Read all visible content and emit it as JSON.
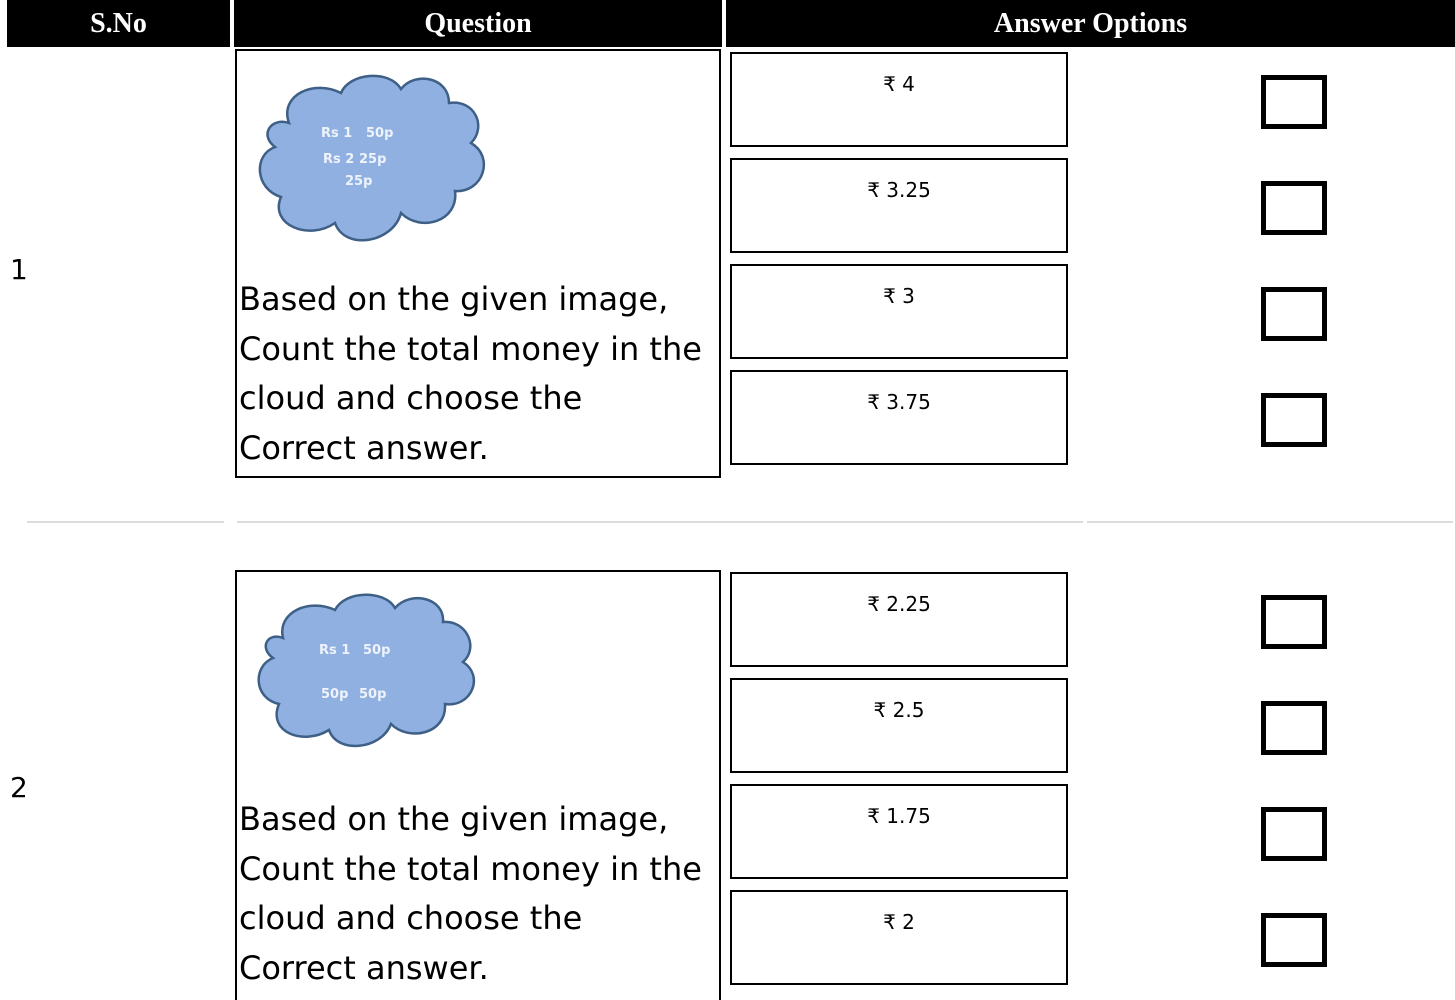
{
  "table": {
    "headers": {
      "sno": "S.No",
      "question": "Question",
      "answer_options": "Answer Options"
    },
    "rows": [
      {
        "sno": "1",
        "cloud_labels": [
          "Rs 1",
          "50p",
          "Rs 2",
          "25p",
          "25p"
        ],
        "question": "Based on the given image, Count the total money in the cloud and choose the Correct answer.",
        "options": [
          "₹ 4",
          "₹ 3.25",
          "₹ 3",
          "₹ 3.75"
        ]
      },
      {
        "sno": "2",
        "cloud_labels": [
          "Rs 1",
          "50p",
          "50p",
          "50p"
        ],
        "question": "Based on the given image, Count the total money in the cloud and choose the Correct answer.",
        "options": [
          "₹ 2.25",
          "₹ 2.5",
          "₹ 1.75",
          "₹ 2"
        ]
      }
    ]
  },
  "colors": {
    "header_bg": "#000000",
    "cloud_fill": "#8fb0e0",
    "cloud_stroke": "#3e5f86"
  },
  "icons": {
    "checkbox": "checkbox-icon",
    "cloud": "cloud-image"
  }
}
